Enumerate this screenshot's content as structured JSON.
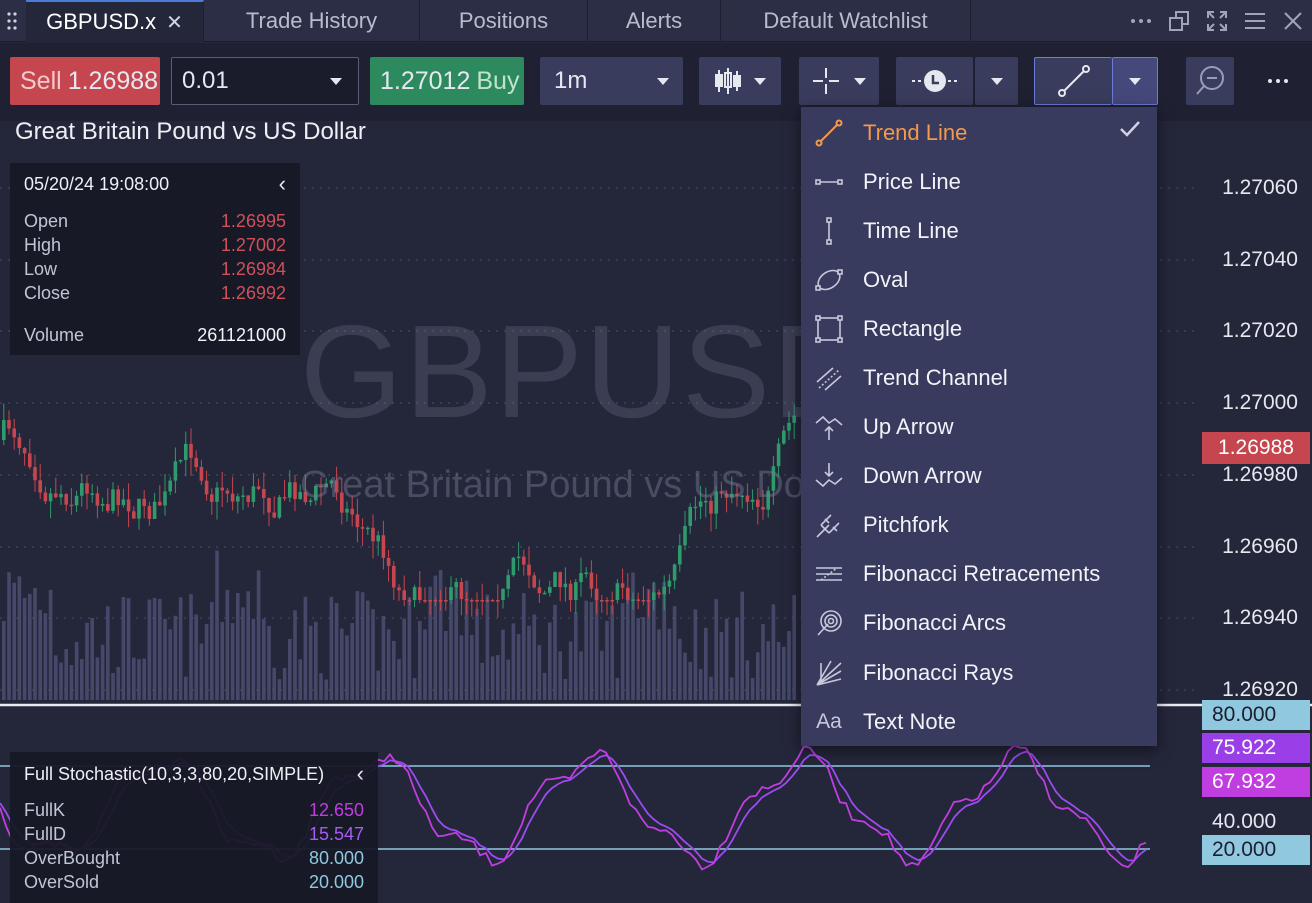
{
  "tabs": [
    {
      "label": "GBPUSD.x",
      "active": true,
      "closable": true
    },
    {
      "label": "Trade History"
    },
    {
      "label": "Positions"
    },
    {
      "label": "Alerts"
    },
    {
      "label": "Default Watchlist"
    }
  ],
  "window_icons": [
    "more-icon",
    "popout-icon",
    "expand-icon",
    "menu-icon",
    "close-icon"
  ],
  "toolbar": {
    "sell_label": "Sell",
    "sell_price": "1.26988",
    "quantity": "0.01",
    "buy_price": "1.27012",
    "buy_label": "Buy",
    "timeframe": "1m",
    "tool_icons": [
      "candlestick-icon",
      "crosshair-icon",
      "clock-icon",
      "trend-line-icon",
      "zoom-out-icon",
      "more-icon"
    ]
  },
  "chart": {
    "title": "Great Britain Pound vs US Dollar",
    "watermark_symbol": "GBPUSD",
    "watermark_name": "Great Britain Pound vs US Dollar",
    "price_axis": [
      "1.27060",
      "1.27040",
      "1.27020",
      "1.27000",
      "1.26980",
      "1.26960",
      "1.26940",
      "1.26920"
    ],
    "current_price": "1.26988",
    "colors": {
      "up": "#2f9a6b",
      "down": "#c6464f",
      "volume": "#505479",
      "stoch_k": "#c03ee0",
      "stoch_d": "#9a4cf0",
      "level": "#8fc8df"
    }
  },
  "ohlc_panel": {
    "datetime": "05/20/24 19:08:00",
    "rows": [
      {
        "label": "Open",
        "value": "1.26995"
      },
      {
        "label": "High",
        "value": "1.27002"
      },
      {
        "label": "Low",
        "value": "1.26984"
      },
      {
        "label": "Close",
        "value": "1.26992"
      }
    ],
    "volume_label": "Volume",
    "volume_value": "261121000"
  },
  "stochastic_panel": {
    "title": "Full Stochastic(10,3,3,80,20,SIMPLE)",
    "rows": [
      {
        "label": "FullK",
        "value": "12.650"
      },
      {
        "label": "FullD",
        "value": "15.547"
      },
      {
        "label": "OverBought",
        "value": "80.000"
      },
      {
        "label": "OverSold",
        "value": "20.000"
      }
    ],
    "axis_tags": [
      "80.000",
      "75.922",
      "67.932",
      "40.000",
      "20.000"
    ]
  },
  "drawing_menu": {
    "items": [
      {
        "label": "Trend Line",
        "icon": "trend-line-icon",
        "selected": true
      },
      {
        "label": "Price Line",
        "icon": "price-line-icon"
      },
      {
        "label": "Time Line",
        "icon": "time-line-icon"
      },
      {
        "label": "Oval",
        "icon": "oval-icon"
      },
      {
        "label": "Rectangle",
        "icon": "rectangle-icon"
      },
      {
        "label": "Trend Channel",
        "icon": "trend-channel-icon"
      },
      {
        "label": "Up Arrow",
        "icon": "up-arrow-icon"
      },
      {
        "label": "Down Arrow",
        "icon": "down-arrow-icon"
      },
      {
        "label": "Pitchfork",
        "icon": "pitchfork-icon"
      },
      {
        "label": "Fibonacci Retracements",
        "icon": "fibonacci-retracements-icon"
      },
      {
        "label": "Fibonacci Arcs",
        "icon": "fibonacci-arcs-icon"
      },
      {
        "label": "Fibonacci Rays",
        "icon": "fibonacci-rays-icon"
      },
      {
        "label": "Text Note",
        "icon": "text-note-icon"
      }
    ]
  }
}
